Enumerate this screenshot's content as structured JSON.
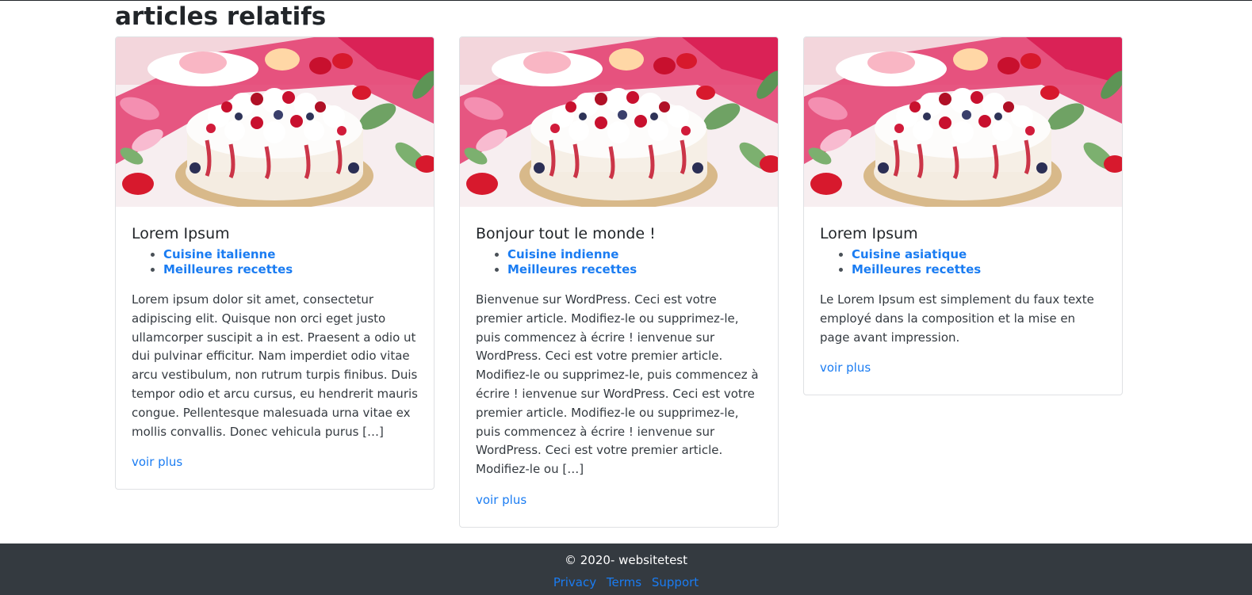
{
  "section": {
    "title": "articles relatifs"
  },
  "cards": [
    {
      "title": "Lorem Ipsum",
      "categories": [
        "Cuisine italienne",
        "Meilleures recettes"
      ],
      "excerpt": "Lorem ipsum dolor sit amet, consectetur adipiscing elit. Quisque non orci eget justo ullamcorper suscipit a in est. Praesent a odio ut dui pulvinar efficitur. Nam imperdiet odio vitae arcu vestibulum, non rutrum turpis finibus. Duis tempor odio et arcu cursus, eu hendrerit mauris congue. Pellentesque malesuada urna vitae ex mollis convallis. Donec vehicula purus […]",
      "link": "voir plus"
    },
    {
      "title": "Bonjour tout le monde !",
      "categories": [
        "Cuisine indienne",
        "Meilleures recettes"
      ],
      "excerpt": "Bienvenue sur WordPress. Ceci est votre premier article. Modifiez-le ou supprimez-le, puis commencez à écrire ! ienvenue sur WordPress. Ceci est votre premier article. Modifiez-le ou supprimez-le, puis commencez à écrire ! ienvenue sur WordPress. Ceci est votre premier article. Modifiez-le ou supprimez-le, puis commencez à écrire ! ienvenue sur WordPress. Ceci est votre premier article. Modifiez-le ou […]",
      "link": "voir plus"
    },
    {
      "title": "Lorem Ipsum",
      "categories": [
        "Cuisine asiatique",
        "Meilleures recettes"
      ],
      "excerpt": "Le Lorem Ipsum est simplement du faux texte employé dans la composition et la mise en page avant impression.",
      "link": "voir plus"
    }
  ],
  "footer": {
    "copyright": "© 2020- websitetest",
    "links": [
      "Privacy",
      "Terms",
      "Support"
    ]
  }
}
